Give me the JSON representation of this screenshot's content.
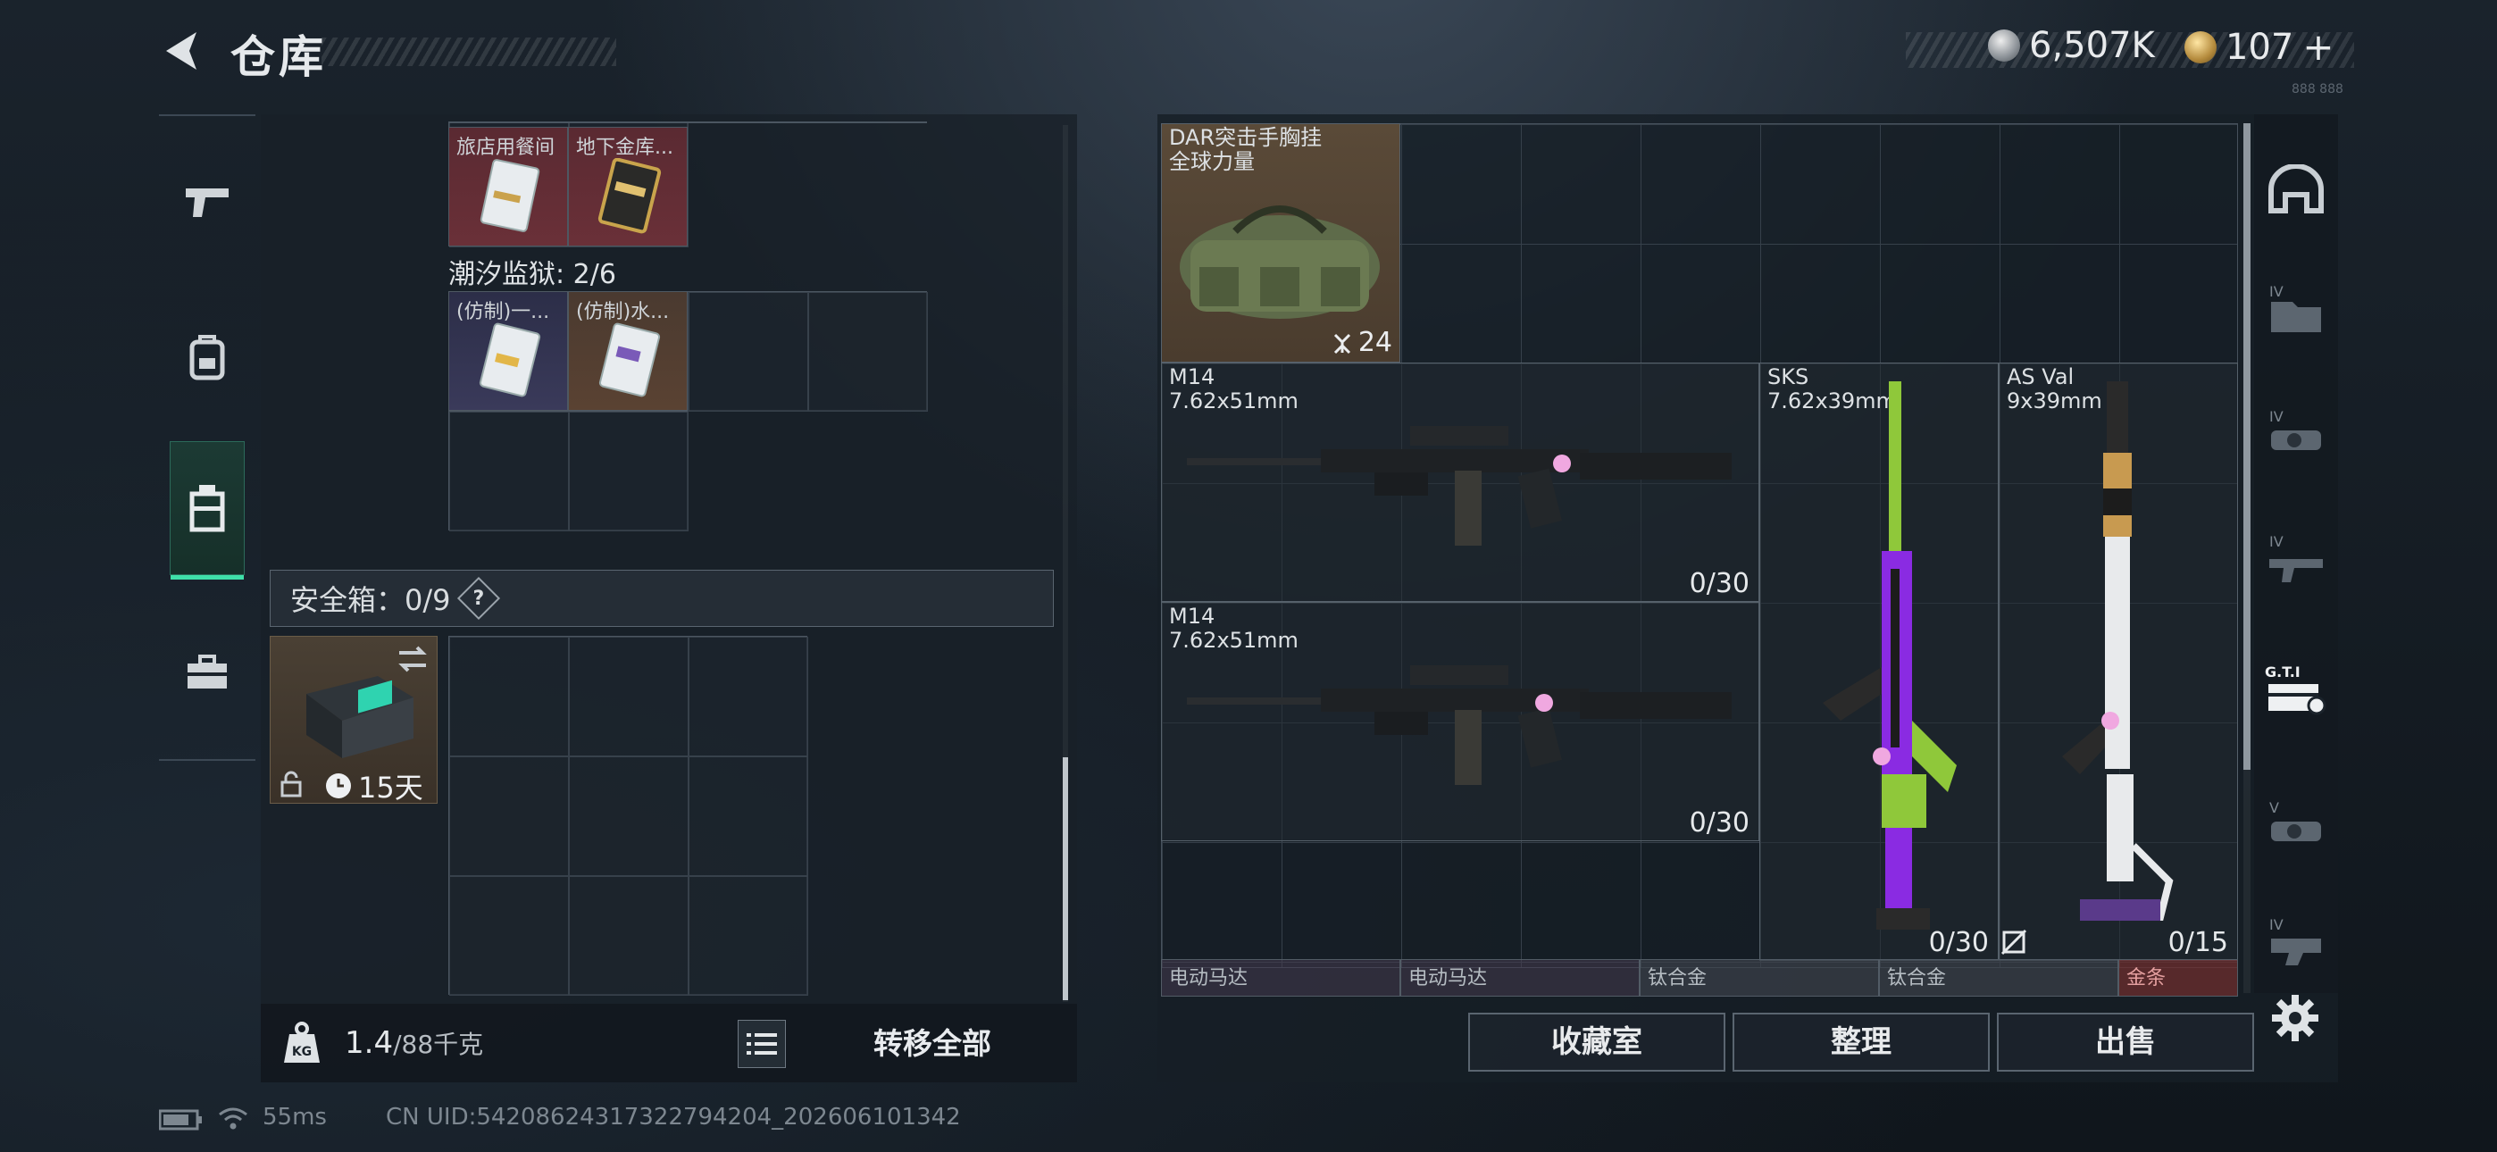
{
  "header": {
    "title": "仓库",
    "currency_silver": "6,507K",
    "currency_gold": "107",
    "plus": "+",
    "tiny_text": "888 888"
  },
  "rail": {
    "items": [
      {
        "name": "pistol-icon"
      },
      {
        "name": "backpack-icon"
      },
      {
        "name": "stash-bag-icon",
        "active": true
      },
      {
        "name": "toolbox-icon"
      }
    ]
  },
  "stash": {
    "top_items": [
      {
        "label": "旅店用餐间"
      },
      {
        "label": "地下金库..."
      }
    ],
    "tidal_prison_label": "潮汐监狱: 2/6",
    "prison_items": [
      {
        "label": "(仿制)一..."
      },
      {
        "label": "(仿制)水..."
      }
    ],
    "safe_box_label": "安全箱：0/9",
    "safe_box_help": "?",
    "safe_box_timer": "15天",
    "weight_value": "1.4",
    "weight_capacity": "/88千克",
    "transfer_all": "转移全部"
  },
  "equipment": {
    "bag": {
      "name_line1": "DAR突击手胸挂",
      "name_line2": "全球力量",
      "capacity": "24"
    },
    "guns": [
      {
        "name": "M14",
        "caliber": "7.62x51mm",
        "ammo": "0/30"
      },
      {
        "name": "M14",
        "caliber": "7.62x51mm",
        "ammo": "0/30"
      },
      {
        "name": "SKS",
        "caliber": "7.62x39mm",
        "ammo": "0/30"
      },
      {
        "name": "AS Val",
        "caliber": "9x39mm",
        "ammo": "0/15"
      }
    ],
    "bottom_items": [
      {
        "label": "电动马达"
      },
      {
        "label": "电动马达"
      },
      {
        "label": "钛合金"
      },
      {
        "label": "钛合金"
      },
      {
        "label": "金条"
      }
    ]
  },
  "actions": {
    "collection": "收藏室",
    "sort": "整理",
    "sell": "出售"
  },
  "side_rail": {
    "items": [
      {
        "name": "helmet-category-icon"
      },
      {
        "name": "tier-iv-folder-icon"
      },
      {
        "name": "tier-iv-scope-icon"
      },
      {
        "name": "tier-iv-rifle-icon"
      },
      {
        "name": "gti-case-icon"
      },
      {
        "name": "tier-v-scope-icon"
      },
      {
        "name": "tier-iv-part-icon"
      }
    ]
  },
  "status": {
    "ping": "55ms",
    "uid": "CN UID:5420862431732279​4204_202606101342"
  },
  "colors": {
    "accent_green": "#3fe0a8",
    "bag_bg": "#5a4a38",
    "purple_strip": "#5a4a6a"
  }
}
